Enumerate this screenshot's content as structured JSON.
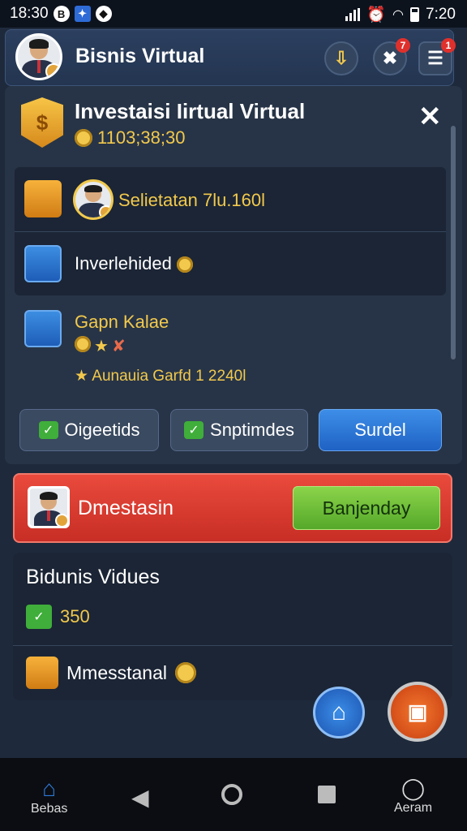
{
  "status_bar": {
    "left_time": "18:30",
    "right_time": "7:20"
  },
  "header": {
    "title": "Bisnis Virtual",
    "notification_badge": "7",
    "menu_badge": "1"
  },
  "hero": {
    "title": "Investaisi Iirtual Virtual",
    "value": "1103;38;30",
    "shield_glyph": "$"
  },
  "list": {
    "row1_label": "Selietatan 7lu.160l",
    "row2_label": "Inverlehided",
    "row3_title": "Gapn Kalae",
    "row3_sub": "Aunauia Garfd 1 2240l"
  },
  "buttons": {
    "b1": "Oigeetids",
    "b2": "Snptimdes",
    "b3": "Surdel"
  },
  "promo": {
    "label": "Dmestasin",
    "cta": "Banjenday"
  },
  "bottom_card": {
    "title": "Bidunis Vidues",
    "value": "350",
    "item": "Mmesstanal"
  },
  "navbar": {
    "home_label": "Bebas",
    "search_label": "Aeram"
  },
  "colors": {
    "accent_gold": "#f2c94c",
    "promo_red": "#e94a3c",
    "cta_green": "#6bbf36",
    "blue_button": "#2f7ad8"
  }
}
